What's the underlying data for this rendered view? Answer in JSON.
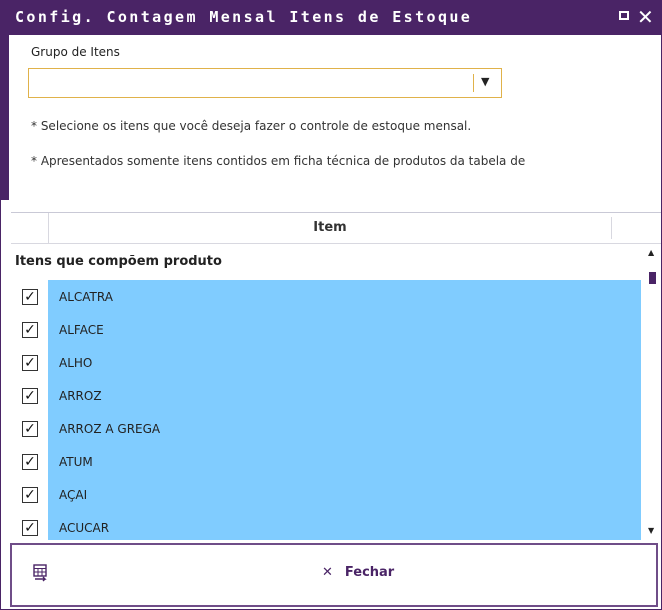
{
  "window": {
    "title": "Config. Contagem Mensal Itens de Estoque",
    "restore_icon": "restore-window-icon",
    "close_icon": "close-icon",
    "close_glyph": "✕",
    "accent_color": "#4a2466"
  },
  "form": {
    "group_label": "Grupo de Itens",
    "group_value": "",
    "dropdown_glyph": "▼",
    "notes": [
      "* Selecione os itens que você deseja fazer o controle de estoque mensal.",
      "* Apresentados somente itens contidos em ficha técnica de produtos da tabela de"
    ]
  },
  "grid": {
    "column_header": "Item",
    "group_title": "Itens que compõem produto",
    "selected_row_color": "#80ccff",
    "check_glyph": "✓",
    "rows": [
      {
        "label": "ALCATRA",
        "checked": true
      },
      {
        "label": "ALFACE",
        "checked": true
      },
      {
        "label": "ALHO",
        "checked": true
      },
      {
        "label": "ARROZ",
        "checked": true
      },
      {
        "label": "ARROZ A GREGA",
        "checked": true
      },
      {
        "label": "ATUM",
        "checked": true
      },
      {
        "label": "AÇAI",
        "checked": true
      },
      {
        "label": "ACUCAR",
        "checked": true
      }
    ],
    "scroll_up_glyph": "▲",
    "scroll_down_glyph": "▼"
  },
  "footer": {
    "export_icon": "export-excel-icon",
    "close_glyph": "✕",
    "close_label": "Fechar"
  }
}
